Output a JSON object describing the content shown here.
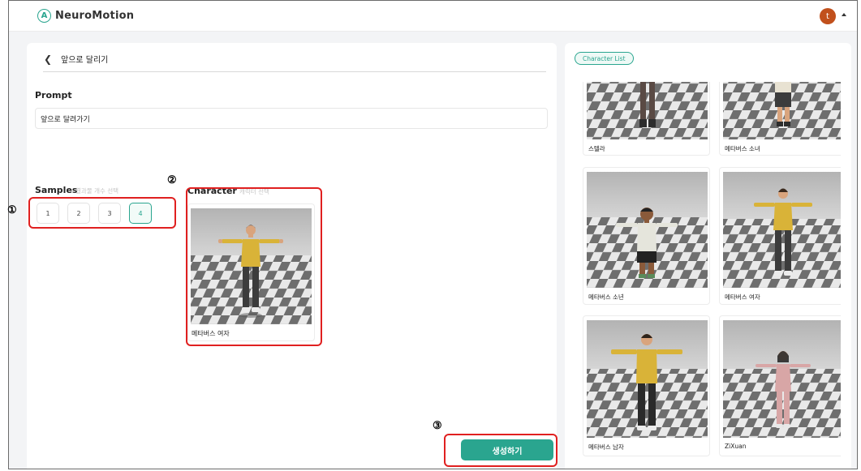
{
  "app": {
    "name": "NeuroMotion",
    "logo_glyph": "A",
    "user_initial": "t"
  },
  "nav": {
    "back_title": "앞으로 달리기"
  },
  "prompt": {
    "label": "Prompt",
    "value": "앞으로 달려가기"
  },
  "samples": {
    "label": "Samples",
    "hint": "결과물 개수 선택",
    "options": [
      "1",
      "2",
      "3",
      "4"
    ],
    "selected": "4"
  },
  "character": {
    "label": "Character",
    "hint": "캐릭터 선택",
    "selected_name": "메타버스 여자"
  },
  "generate_button": "생성하기",
  "character_list": {
    "tab_label": "Character List",
    "items": [
      {
        "name": "스텔라"
      },
      {
        "name": "메타버스 소녀"
      },
      {
        "name": "메타버스 소년"
      },
      {
        "name": "메타버스 여자"
      },
      {
        "name": "메타버스 남자"
      },
      {
        "name": "ZiXuan"
      }
    ]
  },
  "annotations": [
    "①",
    "②",
    "③"
  ],
  "colors": {
    "accent": "#2aa58f",
    "annotation": "#e02020",
    "avatar": "#c1501c"
  }
}
